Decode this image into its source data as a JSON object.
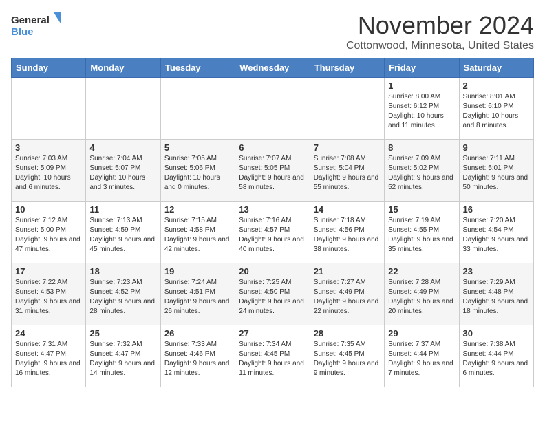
{
  "logo": {
    "text_general": "General",
    "text_blue": "Blue"
  },
  "header": {
    "month": "November 2024",
    "location": "Cottonwood, Minnesota, United States"
  },
  "weekdays": [
    "Sunday",
    "Monday",
    "Tuesday",
    "Wednesday",
    "Thursday",
    "Friday",
    "Saturday"
  ],
  "weeks": [
    [
      {
        "day": "",
        "info": ""
      },
      {
        "day": "",
        "info": ""
      },
      {
        "day": "",
        "info": ""
      },
      {
        "day": "",
        "info": ""
      },
      {
        "day": "",
        "info": ""
      },
      {
        "day": "1",
        "info": "Sunrise: 8:00 AM\nSunset: 6:12 PM\nDaylight: 10 hours and 11 minutes."
      },
      {
        "day": "2",
        "info": "Sunrise: 8:01 AM\nSunset: 6:10 PM\nDaylight: 10 hours and 8 minutes."
      }
    ],
    [
      {
        "day": "3",
        "info": "Sunrise: 7:03 AM\nSunset: 5:09 PM\nDaylight: 10 hours and 6 minutes."
      },
      {
        "day": "4",
        "info": "Sunrise: 7:04 AM\nSunset: 5:07 PM\nDaylight: 10 hours and 3 minutes."
      },
      {
        "day": "5",
        "info": "Sunrise: 7:05 AM\nSunset: 5:06 PM\nDaylight: 10 hours and 0 minutes."
      },
      {
        "day": "6",
        "info": "Sunrise: 7:07 AM\nSunset: 5:05 PM\nDaylight: 9 hours and 58 minutes."
      },
      {
        "day": "7",
        "info": "Sunrise: 7:08 AM\nSunset: 5:04 PM\nDaylight: 9 hours and 55 minutes."
      },
      {
        "day": "8",
        "info": "Sunrise: 7:09 AM\nSunset: 5:02 PM\nDaylight: 9 hours and 52 minutes."
      },
      {
        "day": "9",
        "info": "Sunrise: 7:11 AM\nSunset: 5:01 PM\nDaylight: 9 hours and 50 minutes."
      }
    ],
    [
      {
        "day": "10",
        "info": "Sunrise: 7:12 AM\nSunset: 5:00 PM\nDaylight: 9 hours and 47 minutes."
      },
      {
        "day": "11",
        "info": "Sunrise: 7:13 AM\nSunset: 4:59 PM\nDaylight: 9 hours and 45 minutes."
      },
      {
        "day": "12",
        "info": "Sunrise: 7:15 AM\nSunset: 4:58 PM\nDaylight: 9 hours and 42 minutes."
      },
      {
        "day": "13",
        "info": "Sunrise: 7:16 AM\nSunset: 4:57 PM\nDaylight: 9 hours and 40 minutes."
      },
      {
        "day": "14",
        "info": "Sunrise: 7:18 AM\nSunset: 4:56 PM\nDaylight: 9 hours and 38 minutes."
      },
      {
        "day": "15",
        "info": "Sunrise: 7:19 AM\nSunset: 4:55 PM\nDaylight: 9 hours and 35 minutes."
      },
      {
        "day": "16",
        "info": "Sunrise: 7:20 AM\nSunset: 4:54 PM\nDaylight: 9 hours and 33 minutes."
      }
    ],
    [
      {
        "day": "17",
        "info": "Sunrise: 7:22 AM\nSunset: 4:53 PM\nDaylight: 9 hours and 31 minutes."
      },
      {
        "day": "18",
        "info": "Sunrise: 7:23 AM\nSunset: 4:52 PM\nDaylight: 9 hours and 28 minutes."
      },
      {
        "day": "19",
        "info": "Sunrise: 7:24 AM\nSunset: 4:51 PM\nDaylight: 9 hours and 26 minutes."
      },
      {
        "day": "20",
        "info": "Sunrise: 7:25 AM\nSunset: 4:50 PM\nDaylight: 9 hours and 24 minutes."
      },
      {
        "day": "21",
        "info": "Sunrise: 7:27 AM\nSunset: 4:49 PM\nDaylight: 9 hours and 22 minutes."
      },
      {
        "day": "22",
        "info": "Sunrise: 7:28 AM\nSunset: 4:49 PM\nDaylight: 9 hours and 20 minutes."
      },
      {
        "day": "23",
        "info": "Sunrise: 7:29 AM\nSunset: 4:48 PM\nDaylight: 9 hours and 18 minutes."
      }
    ],
    [
      {
        "day": "24",
        "info": "Sunrise: 7:31 AM\nSunset: 4:47 PM\nDaylight: 9 hours and 16 minutes."
      },
      {
        "day": "25",
        "info": "Sunrise: 7:32 AM\nSunset: 4:47 PM\nDaylight: 9 hours and 14 minutes."
      },
      {
        "day": "26",
        "info": "Sunrise: 7:33 AM\nSunset: 4:46 PM\nDaylight: 9 hours and 12 minutes."
      },
      {
        "day": "27",
        "info": "Sunrise: 7:34 AM\nSunset: 4:45 PM\nDaylight: 9 hours and 11 minutes."
      },
      {
        "day": "28",
        "info": "Sunrise: 7:35 AM\nSunset: 4:45 PM\nDaylight: 9 hours and 9 minutes."
      },
      {
        "day": "29",
        "info": "Sunrise: 7:37 AM\nSunset: 4:44 PM\nDaylight: 9 hours and 7 minutes."
      },
      {
        "day": "30",
        "info": "Sunrise: 7:38 AM\nSunset: 4:44 PM\nDaylight: 9 hours and 6 minutes."
      }
    ]
  ]
}
